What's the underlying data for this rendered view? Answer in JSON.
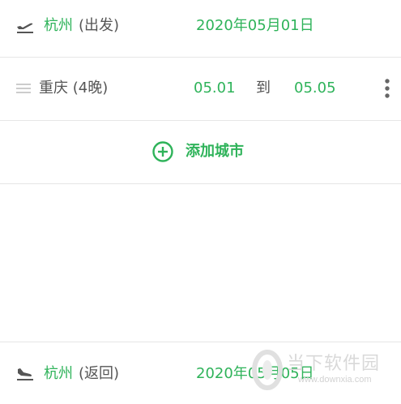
{
  "departure": {
    "city": "杭州",
    "tag": "(出发)",
    "date": "2020年05月01日",
    "icon": "plane-takeoff-icon"
  },
  "stop": {
    "city_nights": "重庆 (4晚)",
    "from": "05.01",
    "to_word": "到",
    "to": "05.05",
    "drag_icon": "drag-handle-icon",
    "more_icon": "more-vertical-icon"
  },
  "add_city": {
    "label": "添加城市",
    "icon": "add-circle-icon"
  },
  "return": {
    "city": "杭州",
    "tag": "(返回)",
    "date": "2020年05月05日",
    "icon": "plane-landing-icon"
  },
  "watermark": {
    "name": "当下软件园",
    "url": "www.downxia.com"
  },
  "colors": {
    "accent": "#2fb35a",
    "text": "#555555",
    "divider": "#e6e6e6"
  }
}
